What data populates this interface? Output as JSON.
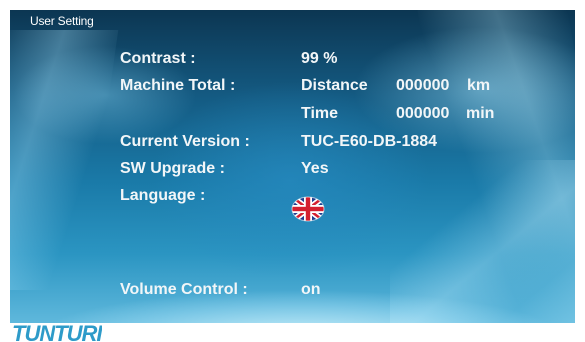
{
  "header": {
    "title": "User Setting"
  },
  "settings": {
    "contrast": {
      "label": "Contrast :",
      "value": "99 %"
    },
    "machine_total": {
      "label": "Machine Total :",
      "distance": {
        "label": "Distance",
        "value": "000000",
        "unit": "km"
      },
      "time": {
        "label": "Time",
        "value": "000000",
        "unit": "min"
      }
    },
    "current_version": {
      "label": "Current Version :",
      "value": "TUC-E60-DB-1884"
    },
    "sw_upgrade": {
      "label": "SW Upgrade :",
      "value": "Yes"
    },
    "language": {
      "label": "Language :",
      "icon": "uk-flag-icon"
    },
    "volume_control": {
      "label": "Volume Control :",
      "value": "on"
    }
  },
  "footer": {
    "brand": "TUNTURI"
  },
  "colors": {
    "text": "#f2f6f8",
    "brand": "#2e9bc9",
    "screen_top": "#0c3652",
    "screen_bottom": "#5fb8dc",
    "flag_blue": "#1f3d8f",
    "flag_red": "#d42030"
  }
}
